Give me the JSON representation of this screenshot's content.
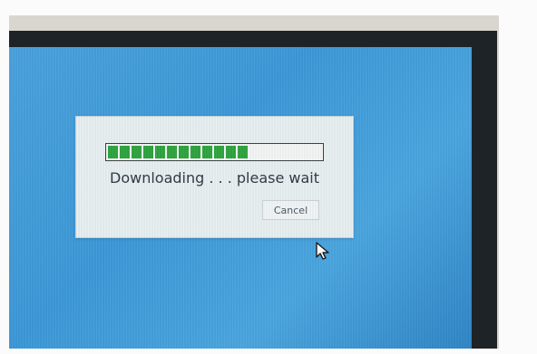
{
  "dialog": {
    "status_text": "Downloading . . . please wait",
    "cancel_label": "Cancel",
    "progress": {
      "segments_filled": 12,
      "percent": 72
    }
  },
  "colors": {
    "progress_fill": "#2fa43f",
    "dialog_bg": "#e8f0f2",
    "desktop": "#3c99d8"
  },
  "icons": {
    "cursor": "mouse-pointer-icon"
  }
}
